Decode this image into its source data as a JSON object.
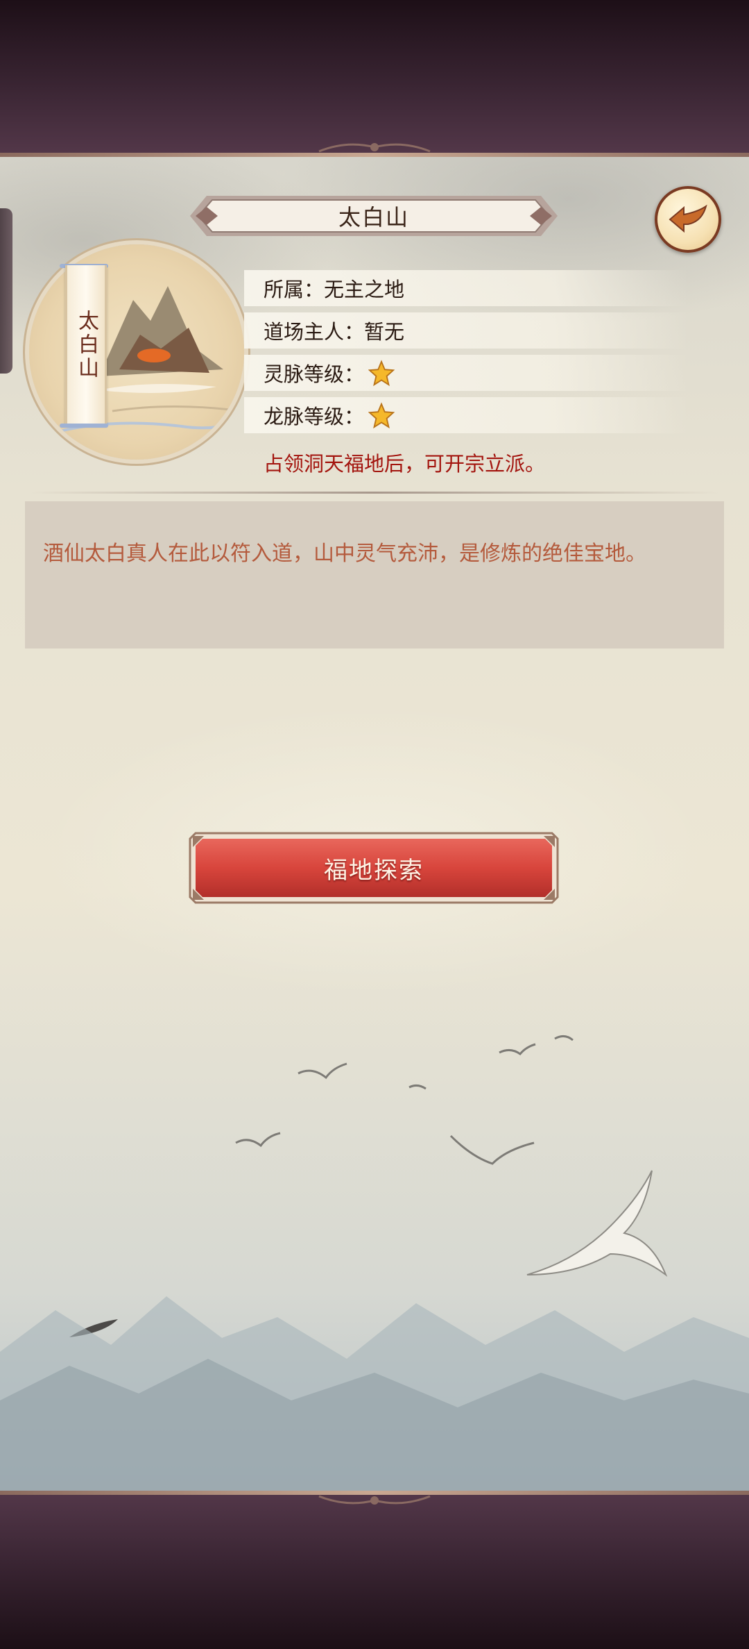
{
  "location": {
    "title": "太白山",
    "scroll_name": "太白山"
  },
  "info": {
    "affiliation_label": "所属：",
    "affiliation_value": "无主之地",
    "owner_label": "道场主人：",
    "owner_value": "暂无",
    "spirit_vein_label": "灵脉等级：",
    "spirit_vein_stars": 1,
    "dragon_vein_label": "龙脉等级：",
    "dragon_vein_stars": 1,
    "hint": "占领洞天福地后，可开宗立派。"
  },
  "description": "酒仙太白真人在此以符入道，山中灵气充沛，是修炼的绝佳宝地。",
  "buttons": {
    "explore_label": "福地探索",
    "back_icon": "back-arrow-icon"
  },
  "colors": {
    "hint_red": "#a3140e",
    "desc_text": "#b45a3c",
    "button_red": "#d8453c",
    "frame_dark": "#3a2533"
  }
}
